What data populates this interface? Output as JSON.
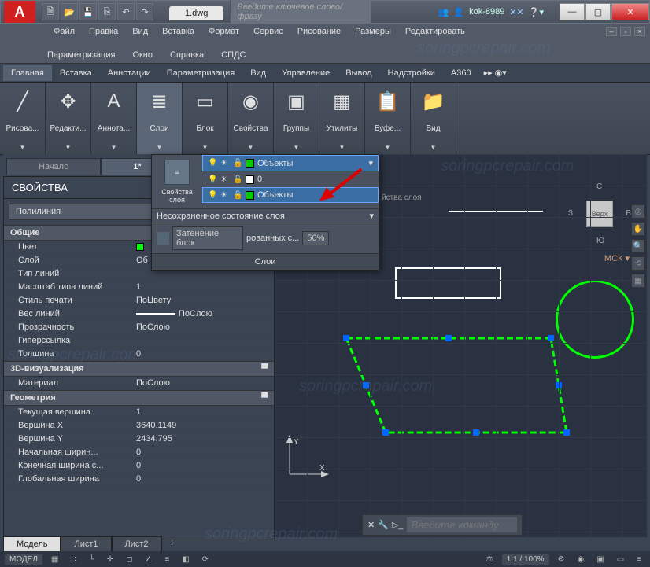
{
  "title": "1.dwg",
  "search_placeholder": "Введите ключевое слово/фразу",
  "user": "kok-8989",
  "menu1": [
    "Файл",
    "Правка",
    "Вид",
    "Вставка",
    "Формат",
    "Сервис",
    "Рисование",
    "Размеры",
    "Редактировать"
  ],
  "menu2": [
    "Параметризация",
    "Окно",
    "Справка",
    "СПДС"
  ],
  "ribbon_tabs": [
    "Главная",
    "Вставка",
    "Аннотации",
    "Параметризация",
    "Вид",
    "Управление",
    "Вывод",
    "Надстройки",
    "A360"
  ],
  "panels": [
    {
      "label": "Рисова...",
      "icon": "line-icon"
    },
    {
      "label": "Редакти...",
      "icon": "move-icon"
    },
    {
      "label": "Аннота...",
      "icon": "text-icon"
    },
    {
      "label": "Слои",
      "icon": "layers-icon",
      "active": true
    },
    {
      "label": "Блок",
      "icon": "block-icon"
    },
    {
      "label": "Свойства",
      "icon": "color-wheel-icon"
    },
    {
      "label": "Группы",
      "icon": "group-icon"
    },
    {
      "label": "Утилиты",
      "icon": "calc-icon"
    },
    {
      "label": "Буфе...",
      "icon": "clipboard-icon"
    },
    {
      "label": "Вид",
      "icon": "folder-icon"
    }
  ],
  "file_tabs": [
    {
      "label": "Начало",
      "active": false
    },
    {
      "label": "1*",
      "active": true
    }
  ],
  "props_title": "СВОЙСТВА",
  "props_selector": "Полилиния",
  "props": [
    {
      "group": "Общие"
    },
    {
      "k": "Цвет",
      "v": "",
      "swatch": true
    },
    {
      "k": "Слой",
      "v": "Об"
    },
    {
      "k": "Тип линий",
      "v": ""
    },
    {
      "k": "Масштаб типа линий",
      "v": "1"
    },
    {
      "k": "Стиль печати",
      "v": "ПоЦвету"
    },
    {
      "k": "Вес линий",
      "v": "ПоСлою",
      "line": true
    },
    {
      "k": "Прозрачность",
      "v": "ПоСлою"
    },
    {
      "k": "Гиперссылка",
      "v": ""
    },
    {
      "k": "Толщина",
      "v": "0"
    },
    {
      "group": "3D-визуализация"
    },
    {
      "k": "Материал",
      "v": "ПоСлою"
    },
    {
      "group": "Геометрия"
    },
    {
      "k": "Текущая вершина",
      "v": "1"
    },
    {
      "k": "Вершина X",
      "v": "3640.1149"
    },
    {
      "k": "Вершина Y",
      "v": "2434.795"
    },
    {
      "k": "Начальная ширин...",
      "v": "0"
    },
    {
      "k": "Конечная ширина с...",
      "v": "0"
    },
    {
      "k": "Глобальная ширина",
      "v": "0"
    }
  ],
  "layer_panel": {
    "side_label": "Свойства слоя",
    "rows": [
      {
        "name": "Объекты",
        "color": "#0c0",
        "sel": true
      },
      {
        "name": "0",
        "color": "#fff",
        "sel": false
      },
      {
        "name": "Объекты",
        "color": "#0c0",
        "sel": true
      }
    ],
    "state": "Несохраненное состояние слоя",
    "tool_text": "Затенение блок",
    "tool_text2": "рованных с...",
    "tool_pct": "50%",
    "footer": "Слои",
    "hint": "йства слоя"
  },
  "cmd_prompt": "Введите команду",
  "sheet_tabs": [
    "Модель",
    "Лист1",
    "Лист2"
  ],
  "status": {
    "mode": "МОДЕЛ",
    "scale": "1:1 / 100%"
  },
  "navcube": {
    "face": "Верх",
    "n": "С",
    "s": "Ю",
    "e": "В",
    "w": "З",
    "label": "МСК"
  },
  "watermark": "soringpcrepair.com"
}
